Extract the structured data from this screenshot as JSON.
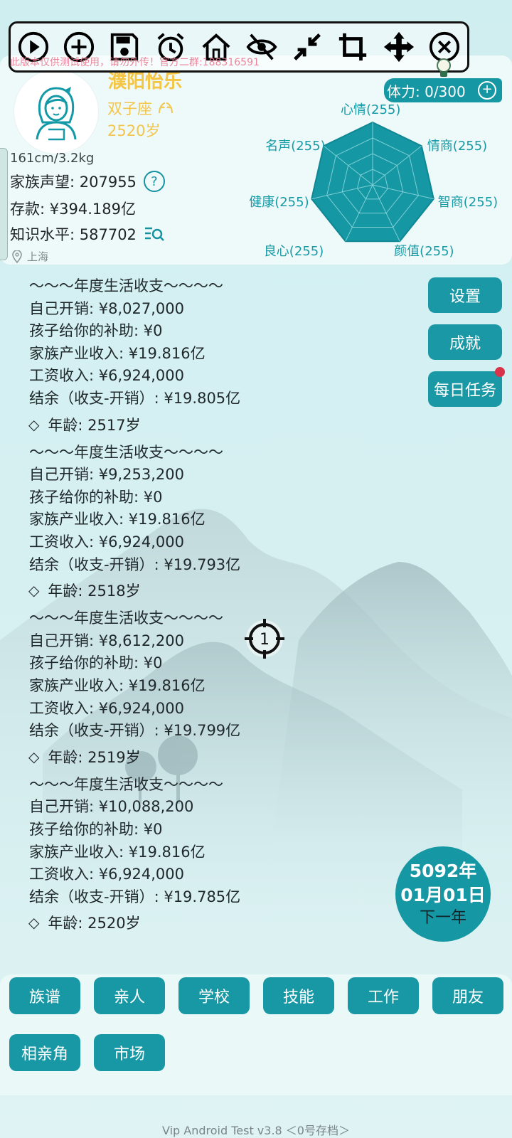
{
  "watermark": "此版本仅供测试使用，请勿外传！官方二群:188316591",
  "toolbar": {
    "icons": [
      "play-icon",
      "add-icon",
      "save-icon",
      "alarm-icon",
      "home-icon",
      "eye-off-icon",
      "collapse-icon",
      "crop-icon",
      "move-icon",
      "close-icon"
    ]
  },
  "profile": {
    "name": "濮阳怡乐",
    "zodiac": "双子座",
    "age": "2520岁",
    "height_weight": "161cm/3.2kg",
    "prestige_label": "家族声望: 207955",
    "savings_label": "存款: ¥394.189亿",
    "knowledge_label": "知识水平: 587702",
    "location": "上海",
    "stamina": "体力: 0/300"
  },
  "radar": {
    "labels": [
      "心情(255)",
      "情商(255)",
      "智商(255)",
      "颜值(255)",
      "良心(255)",
      "健康(255)",
      "名声(255)"
    ],
    "values": [
      255,
      255,
      255,
      255,
      255,
      255,
      255
    ],
    "max": 255
  },
  "side_buttons": [
    "设置",
    "成就",
    "每日任务"
  ],
  "log": [
    {
      "type": "header",
      "text": "～～～年度生活收支～～～～"
    },
    {
      "type": "line",
      "text": "自己开销: ¥8,027,000"
    },
    {
      "type": "line",
      "text": "孩子给你的补助: ¥0"
    },
    {
      "type": "line",
      "text": "家族产业收入: ¥19.816亿"
    },
    {
      "type": "line",
      "text": "工资收入: ¥6,924,000"
    },
    {
      "type": "line",
      "text": "结余（收支-开销）: ¥19.805亿"
    },
    {
      "type": "age",
      "text": "年龄: 2517岁"
    },
    {
      "type": "header",
      "text": "～～～年度生活收支～～～～"
    },
    {
      "type": "line",
      "text": "自己开销: ¥9,253,200"
    },
    {
      "type": "line",
      "text": "孩子给你的补助: ¥0"
    },
    {
      "type": "line",
      "text": "家族产业收入: ¥19.816亿"
    },
    {
      "type": "line",
      "text": "工资收入: ¥6,924,000"
    },
    {
      "type": "line",
      "text": "结余（收支-开销）: ¥19.793亿"
    },
    {
      "type": "age",
      "text": "年龄: 2518岁"
    },
    {
      "type": "header",
      "text": "～～～年度生活收支～～～～"
    },
    {
      "type": "line",
      "text": "自己开销: ¥8,612,200"
    },
    {
      "type": "line",
      "text": "孩子给你的补助: ¥0"
    },
    {
      "type": "line",
      "text": "家族产业收入: ¥19.816亿"
    },
    {
      "type": "line",
      "text": "工资收入: ¥6,924,000"
    },
    {
      "type": "line",
      "text": "结余（收支-开销）: ¥19.799亿"
    },
    {
      "type": "age",
      "text": "年龄: 2519岁"
    },
    {
      "type": "header",
      "text": "～～～年度生活收支～～～～"
    },
    {
      "type": "line",
      "text": "自己开销: ¥10,088,200"
    },
    {
      "type": "line",
      "text": "孩子给你的补助: ¥0"
    },
    {
      "type": "line",
      "text": "家族产业收入: ¥19.816亿"
    },
    {
      "type": "line",
      "text": "工资收入: ¥6,924,000"
    },
    {
      "type": "line",
      "text": "结余（收支-开销）: ¥19.785亿"
    },
    {
      "type": "age",
      "text": "年龄: 2520岁"
    }
  ],
  "target_badge": "1",
  "date": {
    "year": "5092年",
    "day": "01月01日",
    "next": "下一年"
  },
  "nav": [
    "族谱",
    "亲人",
    "学校",
    "技能",
    "工作",
    "朋友",
    "相亲角",
    "市场"
  ],
  "footer": "Vip Android Test v3.8 ＜0号存档＞",
  "colors": {
    "accent": "#1597a4",
    "gold": "#f4c443",
    "watermark": "#e97a92",
    "badge": "#d9334c"
  }
}
